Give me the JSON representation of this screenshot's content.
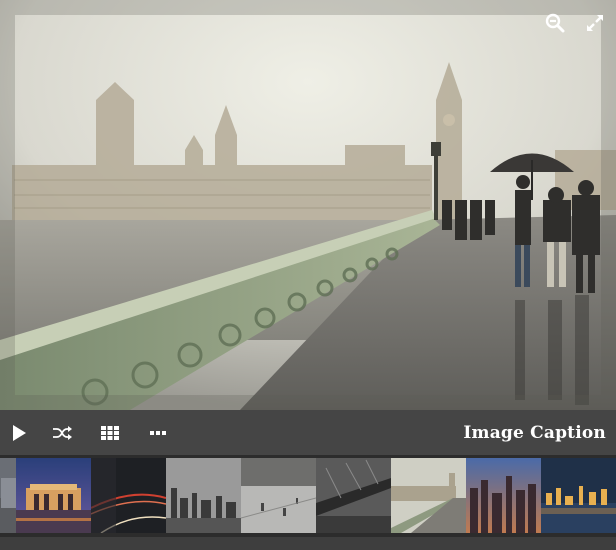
{
  "viewer": {
    "caption": "Image Caption"
  },
  "top_controls": {
    "zoom_out_icon": "zoom-out-icon",
    "fullscreen_icon": "fullscreen-icon"
  },
  "toolbar": {
    "play_icon": "play-icon",
    "shuffle_icon": "shuffle-icon",
    "grid_icon": "grid-icon",
    "more_icon": "ellipsis-icon"
  },
  "thumbnails": {
    "count": 9,
    "selected_index": 0
  },
  "colors": {
    "toolbar_bg": "#454545",
    "thumb_strip_bg": "#2c2c2c",
    "icon": "#ffffff"
  }
}
